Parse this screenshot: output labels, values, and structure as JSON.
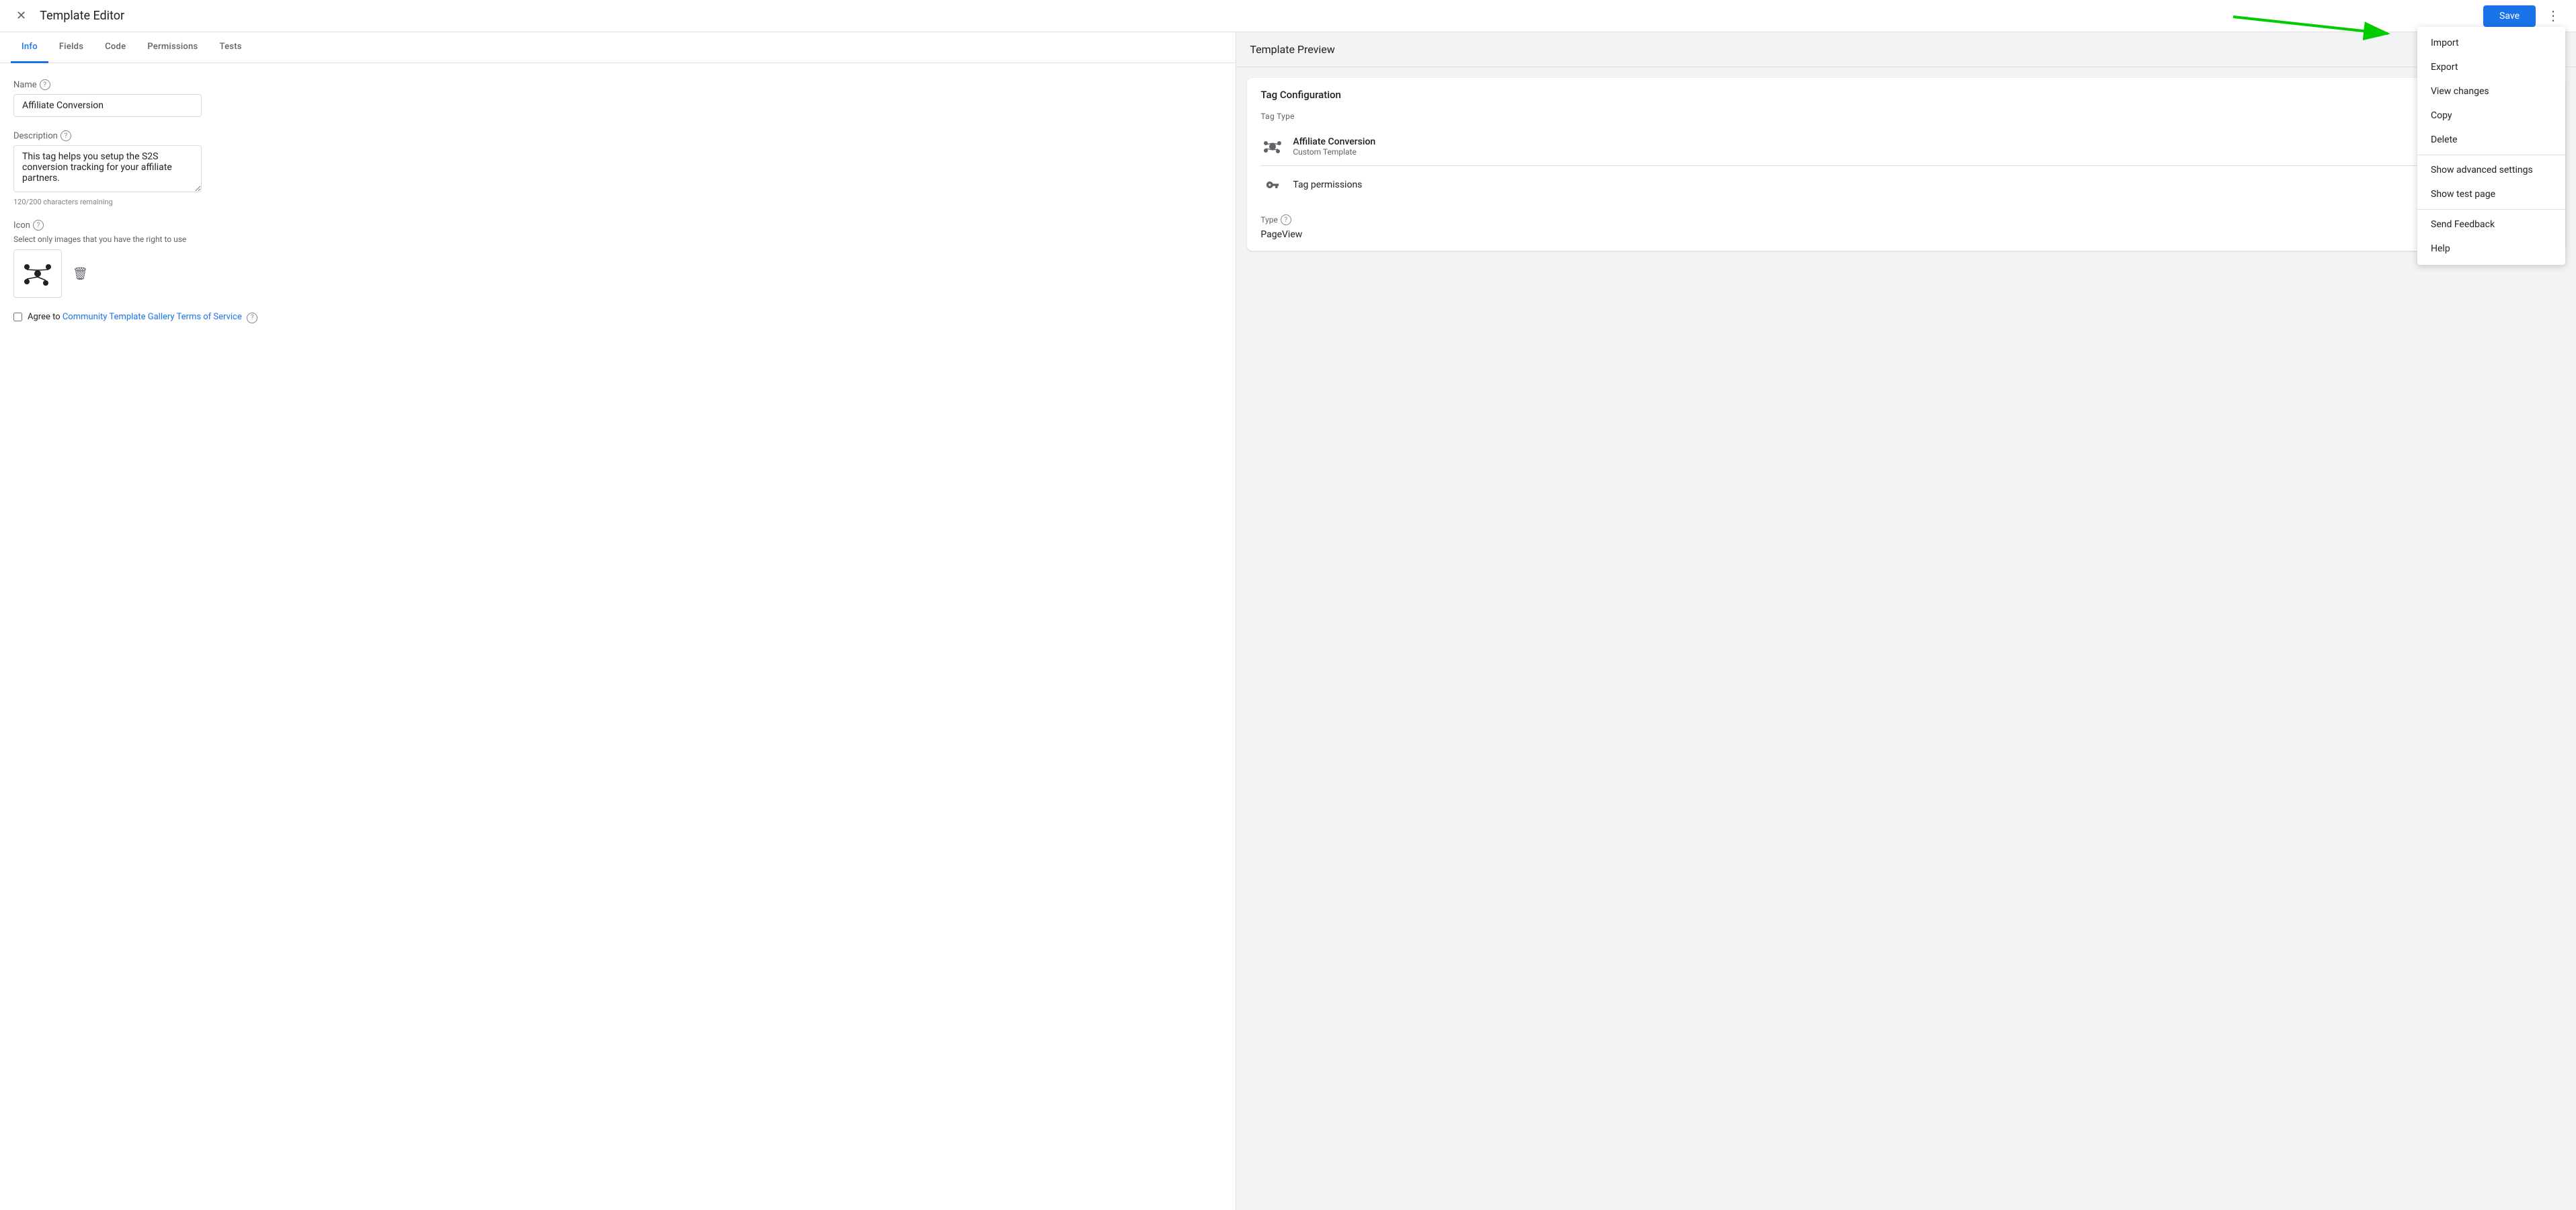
{
  "topbar": {
    "close_icon": "✕",
    "title": "Template Editor",
    "save_label": "Save",
    "more_icon": "⋮"
  },
  "tabs": [
    {
      "label": "Info",
      "active": true
    },
    {
      "label": "Fields",
      "active": false
    },
    {
      "label": "Code",
      "active": false
    },
    {
      "label": "Permissions",
      "active": false
    },
    {
      "label": "Tests",
      "active": false
    }
  ],
  "info_form": {
    "name_label": "Name",
    "name_value": "Affiliate Conversion",
    "description_label": "Description",
    "description_value": "This tag helps you setup the S2S conversion tracking for your affiliate partners.",
    "char_count": "120/200 characters remaining",
    "icon_label": "Icon",
    "icon_note": "Select only images that you have the right to use",
    "checkbox_prefix": "Agree to ",
    "terms_link_text": "Community Template Gallery Terms of Service",
    "help_icon": "?"
  },
  "right_panel": {
    "header": "Template Preview",
    "tag_config_title": "Tag Configuration",
    "tag_type_label": "Tag Type",
    "tag_name": "Affiliate Conversion",
    "tag_sub": "Custom Template",
    "permissions_label": "Tag permissions",
    "type_section_label": "Type",
    "type_value": "PageView"
  },
  "dropdown_menu": {
    "items": [
      {
        "label": "Import",
        "highlighted": true
      },
      {
        "label": "Export"
      },
      {
        "label": "View changes"
      },
      {
        "label": "Copy"
      },
      {
        "label": "Delete"
      },
      {
        "label": "Show advanced settings"
      },
      {
        "label": "Show test page"
      },
      {
        "label": "Send Feedback"
      },
      {
        "label": "Help"
      }
    ]
  }
}
